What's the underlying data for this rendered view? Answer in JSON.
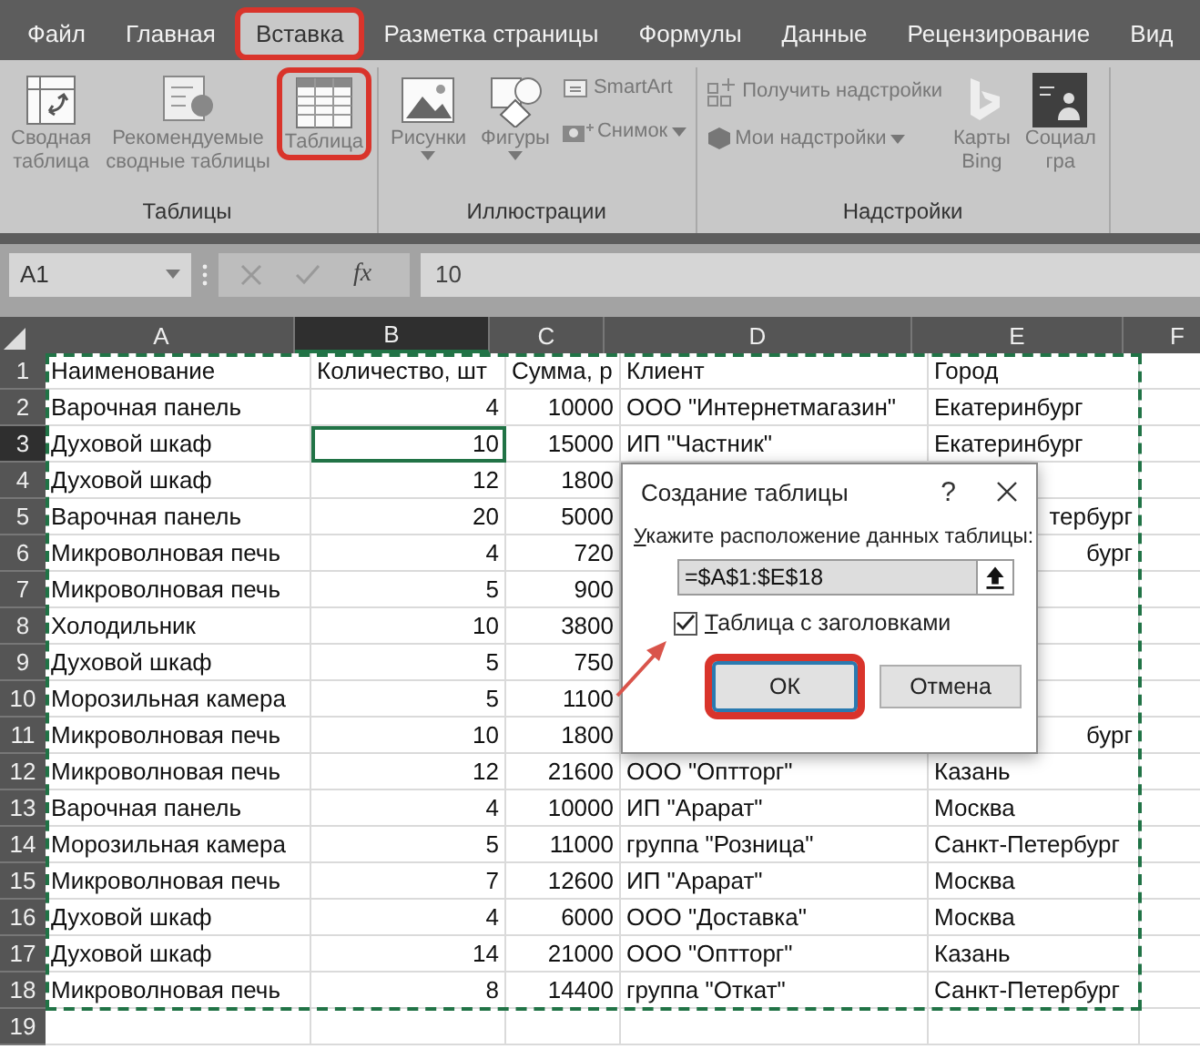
{
  "menu_tabs": [
    {
      "label": "Файл",
      "selected": false,
      "highlighted": false
    },
    {
      "label": "Главная",
      "selected": false,
      "highlighted": false
    },
    {
      "label": "Вставка",
      "selected": true,
      "highlighted": true
    },
    {
      "label": "Разметка страницы",
      "selected": false,
      "highlighted": false
    },
    {
      "label": "Формулы",
      "selected": false,
      "highlighted": false
    },
    {
      "label": "Данные",
      "selected": false,
      "highlighted": false
    },
    {
      "label": "Рецензирование",
      "selected": false,
      "highlighted": false
    },
    {
      "label": "Вид",
      "selected": false,
      "highlighted": false
    }
  ],
  "ribbon": {
    "groups": [
      {
        "title": "Таблицы",
        "items": [
          {
            "label": "Сводная\nтаблица",
            "kind": "large",
            "highlighted": false
          },
          {
            "label": "Рекомендуемые\nсводные таблицы",
            "kind": "large",
            "highlighted": false
          },
          {
            "label": "Таблица",
            "kind": "large",
            "highlighted": true
          }
        ]
      },
      {
        "title": "Иллюстрации",
        "items": [
          {
            "label": "Рисунки",
            "kind": "large_dropdown",
            "highlighted": false
          },
          {
            "label": "Фигуры",
            "kind": "large_dropdown",
            "highlighted": false
          },
          {
            "label": "SmartArt",
            "kind": "small",
            "highlighted": false
          },
          {
            "label": "Снимок",
            "kind": "small_dropdown",
            "highlighted": false
          }
        ]
      },
      {
        "title": "Надстройки",
        "items": [
          {
            "label": "Получить надстройки",
            "kind": "small",
            "highlighted": false
          },
          {
            "label": "Мои надстройки",
            "kind": "small_dropdown",
            "highlighted": false
          },
          {
            "label": "Карты\nBing",
            "kind": "large",
            "highlighted": false
          },
          {
            "label": "Социал\nгра",
            "kind": "large",
            "highlighted": false
          }
        ]
      }
    ]
  },
  "formula_bar": {
    "name_box": "A1",
    "function_label": "fx",
    "value": "10"
  },
  "sheet": {
    "columns": [
      {
        "label": "A",
        "selected": false,
        "numeric": false
      },
      {
        "label": "B",
        "selected": true,
        "numeric": true
      },
      {
        "label": "C",
        "selected": false,
        "numeric": true
      },
      {
        "label": "D",
        "selected": false,
        "numeric": false
      },
      {
        "label": "E",
        "selected": false,
        "numeric": false
      },
      {
        "label": "F",
        "selected": false,
        "numeric": false
      }
    ],
    "rows": [
      {
        "number": "1",
        "selected": false,
        "kind": "header",
        "cells": [
          "Наименование",
          "Количество, шт",
          "Сумма, р",
          "Клиент",
          "Город"
        ]
      },
      {
        "number": "2",
        "selected": false,
        "kind": "data",
        "cells": [
          "Варочная панель",
          "4",
          "10000",
          "ООО \"Интернетмагазин\"",
          "Екатеринбург"
        ]
      },
      {
        "number": "3",
        "selected": true,
        "kind": "data",
        "cells": [
          "Духовой шкаф",
          "10",
          "15000",
          "ИП \"Частник\"",
          "Екатеринбург"
        ]
      },
      {
        "number": "4",
        "selected": false,
        "kind": "data",
        "cells": [
          "Духовой шкаф",
          "12",
          "1800",
          null,
          null
        ]
      },
      {
        "number": "5",
        "selected": false,
        "kind": "data",
        "cells": [
          "Варочная панель",
          "20",
          "5000",
          null,
          "тербург"
        ]
      },
      {
        "number": "6",
        "selected": false,
        "kind": "data",
        "cells": [
          "Микроволновая печь",
          "4",
          "720",
          null,
          "бург"
        ]
      },
      {
        "number": "7",
        "selected": false,
        "kind": "data",
        "cells": [
          "Микроволновая печь",
          "5",
          "900",
          null,
          null
        ]
      },
      {
        "number": "8",
        "selected": false,
        "kind": "data",
        "cells": [
          "Холодильник",
          "10",
          "3800",
          null,
          null
        ]
      },
      {
        "number": "9",
        "selected": false,
        "kind": "data",
        "cells": [
          "Духовой шкаф",
          "5",
          "750",
          null,
          null
        ]
      },
      {
        "number": "10",
        "selected": false,
        "kind": "data",
        "cells": [
          "Морозильная камера",
          "5",
          "1100",
          null,
          null
        ]
      },
      {
        "number": "11",
        "selected": false,
        "kind": "data",
        "cells": [
          "Микроволновая печь",
          "10",
          "1800",
          null,
          "бург"
        ]
      },
      {
        "number": "12",
        "selected": false,
        "kind": "data",
        "cells": [
          "Микроволновая печь",
          "12",
          "21600",
          "ООО \"Оптторг\"",
          "Казань"
        ]
      },
      {
        "number": "13",
        "selected": false,
        "kind": "data",
        "cells": [
          "Варочная панель",
          "4",
          "10000",
          "ИП \"Арарат\"",
          "Москва"
        ]
      },
      {
        "number": "14",
        "selected": false,
        "kind": "data",
        "cells": [
          "Морозильная камера",
          "5",
          "11000",
          "группа \"Розница\"",
          "Санкт-Петербург"
        ]
      },
      {
        "number": "15",
        "selected": false,
        "kind": "data",
        "cells": [
          "Микроволновая печь",
          "7",
          "12600",
          "ИП \"Арарат\"",
          "Москва"
        ]
      },
      {
        "number": "16",
        "selected": false,
        "kind": "data",
        "cells": [
          "Духовой шкаф",
          "4",
          "6000",
          "ООО \"Доставка\"",
          "Москва"
        ]
      },
      {
        "number": "17",
        "selected": false,
        "kind": "data",
        "cells": [
          "Духовой шкаф",
          "14",
          "21000",
          "ООО \"Оптторг\"",
          "Казань"
        ]
      },
      {
        "number": "18",
        "selected": false,
        "kind": "data",
        "cells": [
          "Микроволновая печь",
          "8",
          "14400",
          "группа \"Откат\"",
          "Санкт-Петербург"
        ]
      },
      {
        "number": "19",
        "selected": false,
        "kind": "data",
        "cells": []
      }
    ]
  },
  "dialog": {
    "title": "Создание таблицы",
    "help": "?",
    "prompt": "Укажите расположение данных таблицы:",
    "range": "=$A$1:$E$18",
    "header_checkbox": {
      "label": "Таблица с заголовками",
      "checked": true
    },
    "buttons": [
      {
        "label": "ОК",
        "default": true,
        "highlighted": true
      },
      {
        "label": "Отмена",
        "default": false,
        "highlighted": false
      }
    ]
  }
}
